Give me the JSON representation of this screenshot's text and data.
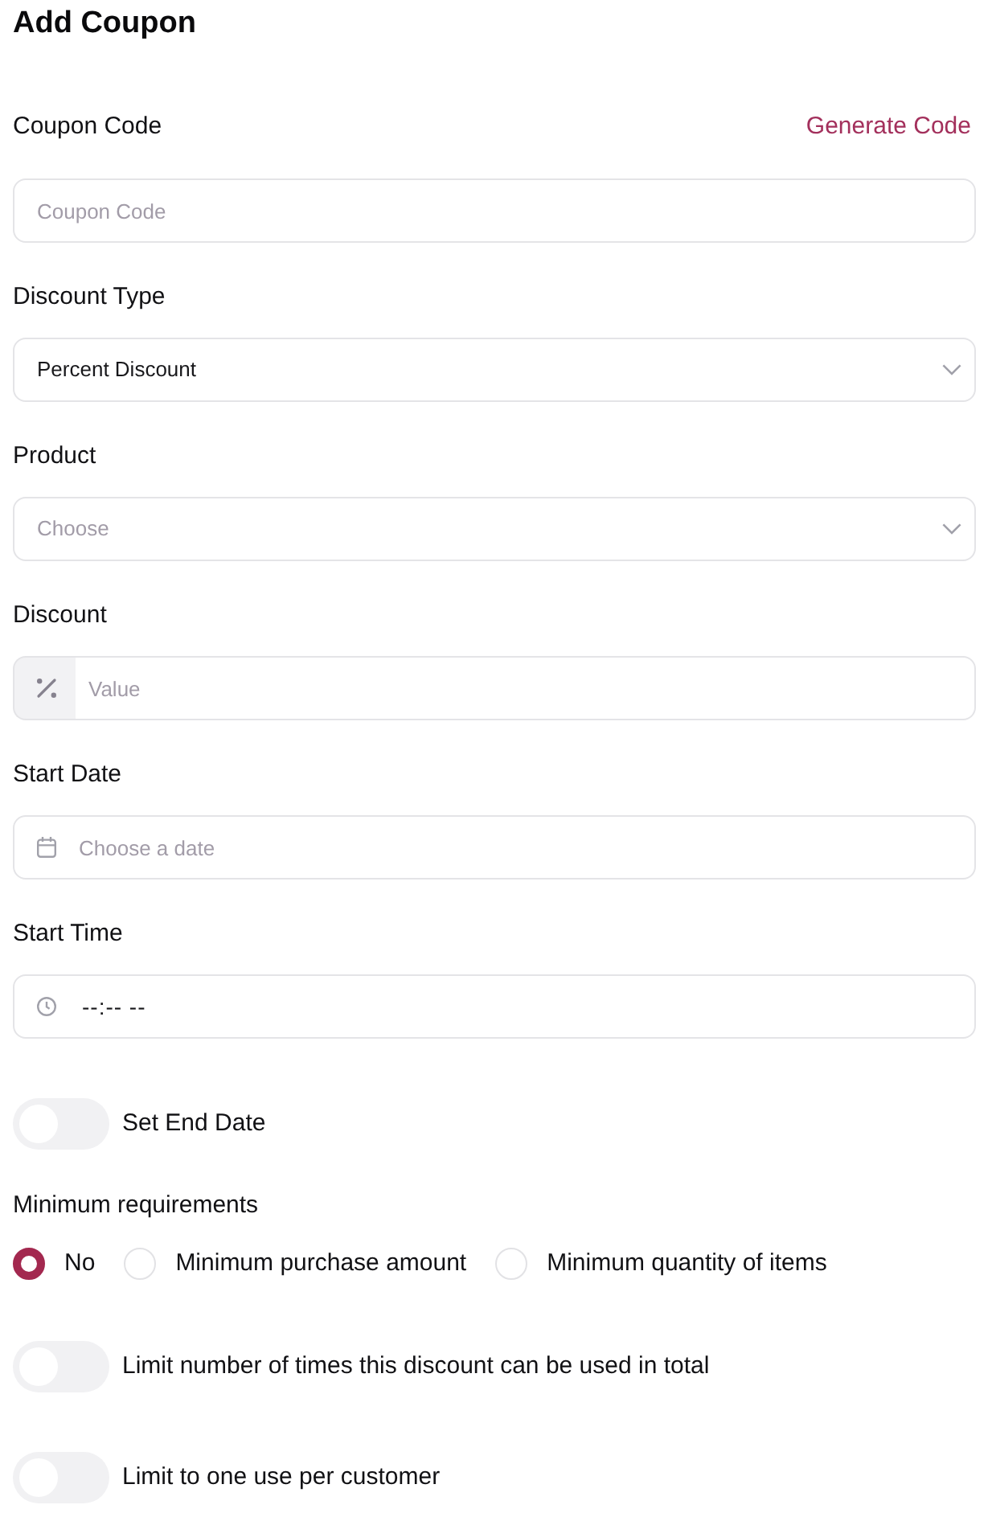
{
  "title": "Add Coupon",
  "fields": [
    {
      "kind": "text",
      "label": "Coupon Code",
      "link": "Generate Code",
      "placeholder": "Coupon Code"
    },
    {
      "kind": "select",
      "label": "Discount Type",
      "value": "Percent Discount"
    },
    {
      "kind": "select",
      "label": "Product",
      "placeholder": "Choose"
    },
    {
      "kind": "addon",
      "label": "Discount",
      "placeholder": "Value"
    },
    {
      "kind": "date",
      "label": "Start Date",
      "placeholder": "Choose a date"
    },
    {
      "kind": "time",
      "label": "Start Time",
      "value": "--:-- --"
    }
  ],
  "end_date_switch": {
    "label": "Set End Date",
    "on": false
  },
  "minimum_requirements": {
    "label": "Minimum requirements",
    "options": [
      {
        "label": "No",
        "selected": true
      },
      {
        "label": "Minimum purchase amount",
        "selected": false
      },
      {
        "label": "Minimum quantity of items",
        "selected": false
      }
    ]
  },
  "limit_switches": [
    {
      "label": "Limit number of times this discount can be used in total",
      "on": false
    },
    {
      "label": "Limit to one use per customer",
      "on": false
    }
  ]
}
